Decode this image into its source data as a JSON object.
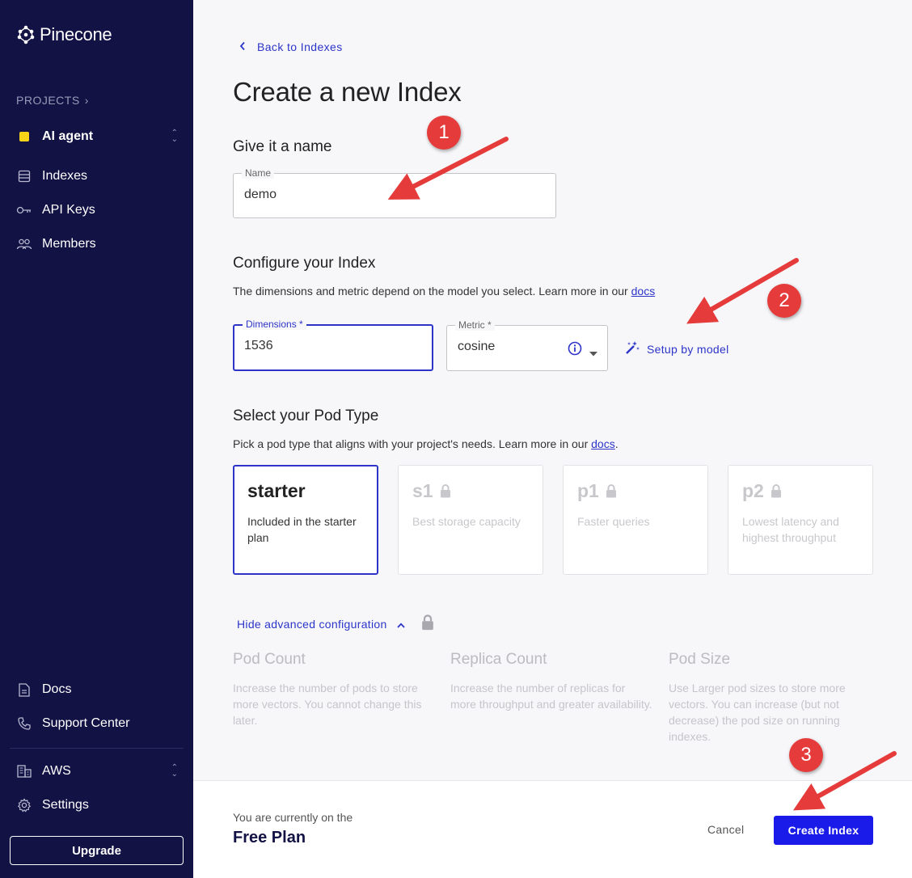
{
  "sidebar": {
    "brand": "Pinecone",
    "projects_label": "PROJECTS",
    "project_name": "AI agent",
    "nav": [
      {
        "label": "Indexes",
        "icon": "list-icon"
      },
      {
        "label": "API Keys",
        "icon": "key-icon"
      },
      {
        "label": "Members",
        "icon": "members-icon"
      }
    ],
    "bottom_nav": [
      {
        "label": "Docs",
        "icon": "document-icon"
      },
      {
        "label": "Support Center",
        "icon": "phone-icon"
      },
      {
        "label": "AWS",
        "icon": "building-icon"
      },
      {
        "label": "Settings",
        "icon": "gear-icon"
      }
    ],
    "upgrade_label": "Upgrade"
  },
  "main": {
    "back_label": "Back to Indexes",
    "title": "Create a new Index",
    "name_section": {
      "heading": "Give it a name",
      "field_label": "Name",
      "field_value": "demo"
    },
    "configure_section": {
      "heading": "Configure your Index",
      "description": "The dimensions and metric depend on the model you select. Learn more in our",
      "docs_link": "docs",
      "dimensions_label": "Dimensions *",
      "dimensions_value": "1536",
      "metric_label": "Metric *",
      "metric_value": "cosine",
      "setup_link": "Setup by model"
    },
    "pod_section": {
      "heading": "Select your Pod Type",
      "description": "Pick a pod type that aligns with your project's needs. Learn more in our",
      "docs_link": "docs",
      "pods": [
        {
          "name": "starter",
          "desc": "Included in the starter plan",
          "locked": false,
          "selected": true
        },
        {
          "name": "s1",
          "desc": "Best storage capacity",
          "locked": true,
          "selected": false
        },
        {
          "name": "p1",
          "desc": "Faster queries",
          "locked": true,
          "selected": false
        },
        {
          "name": "p2",
          "desc": "Lowest latency and highest throughput",
          "locked": true,
          "selected": false
        }
      ]
    },
    "advanced": {
      "toggle_label": "Hide advanced configuration",
      "columns": [
        {
          "title": "Pod Count",
          "desc": "Increase the number of pods to store more vectors. You cannot change this later."
        },
        {
          "title": "Replica Count",
          "desc": "Increase the number of replicas for more throughput and greater availability."
        },
        {
          "title": "Pod Size",
          "desc": "Use Larger pod sizes to store more vectors. You can increase (but not decrease) the pod size on running indexes."
        }
      ]
    }
  },
  "footer": {
    "plan_note": "You are currently on the",
    "plan_name": "Free Plan",
    "cancel_label": "Cancel",
    "create_label": "Create Index"
  },
  "annotations": {
    "badges": [
      "1",
      "2",
      "3"
    ],
    "color": "#e53b3b"
  },
  "colors": {
    "sidebar_bg": "#131245",
    "accent": "#2c35c8",
    "primary_button": "#1a1be8",
    "project_dot": "#f7d417"
  }
}
